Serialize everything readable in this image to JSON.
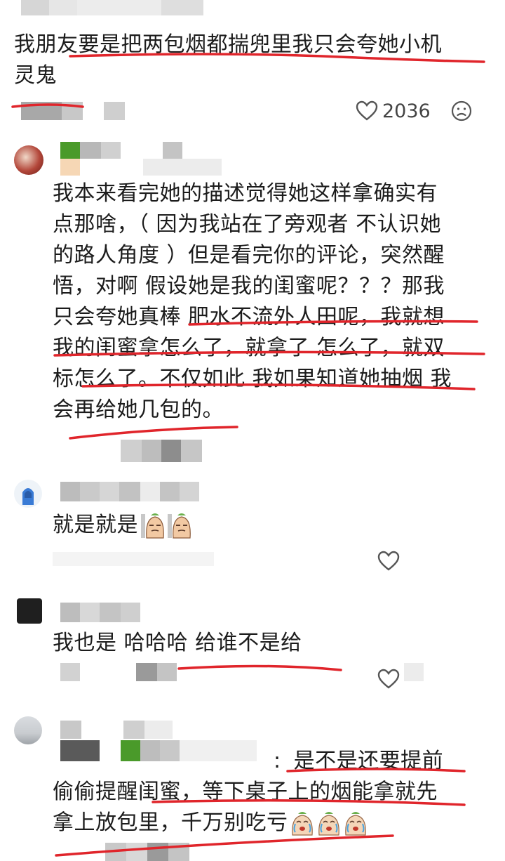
{
  "comments": [
    {
      "text_lines": [
        "我朋友要是把两包烟都揣兜里我只会夸她小机",
        "灵鬼"
      ],
      "likes": "2036"
    },
    {
      "text_lines": [
        "我本来看完她的描述觉得她这样拿确实有",
        "点那啥，（ 因为我站在了旁观者 不认识她",
        "的路人角度 ）但是看完你的评论，突然醒",
        "悟，对啊 假设她是我的闺蜜呢？？？那我",
        "只会夸她真棒 肥水不流外人田呢，我就想",
        "我的闺蜜拿怎么了，就拿了 怎么了，就双",
        "标怎么了。不仅如此 我如果知道她抽烟 我",
        "会再给她几包的。"
      ]
    },
    {
      "text": "就是就是"
    },
    {
      "text": "我也是 哈哈哈 给谁不是给"
    },
    {
      "reply_separator": ":",
      "text_lines": [
        "是不是还要提前",
        "偷偷提醒闺蜜，等下桌子上的烟能拿就先",
        "拿上放包里，千万别吃亏"
      ]
    }
  ],
  "icons": {
    "like": "heart-outline-icon",
    "dislike": "sad-face-icon",
    "emoji": "crying-bean-emoji",
    "sticker": "smirking-bean-sticker"
  },
  "colors": {
    "text": "#1c1c1c",
    "annotation": "#e0252b",
    "mosaic_gray": "#c8c8c8",
    "mosaic_green": "#4a9a2a"
  }
}
